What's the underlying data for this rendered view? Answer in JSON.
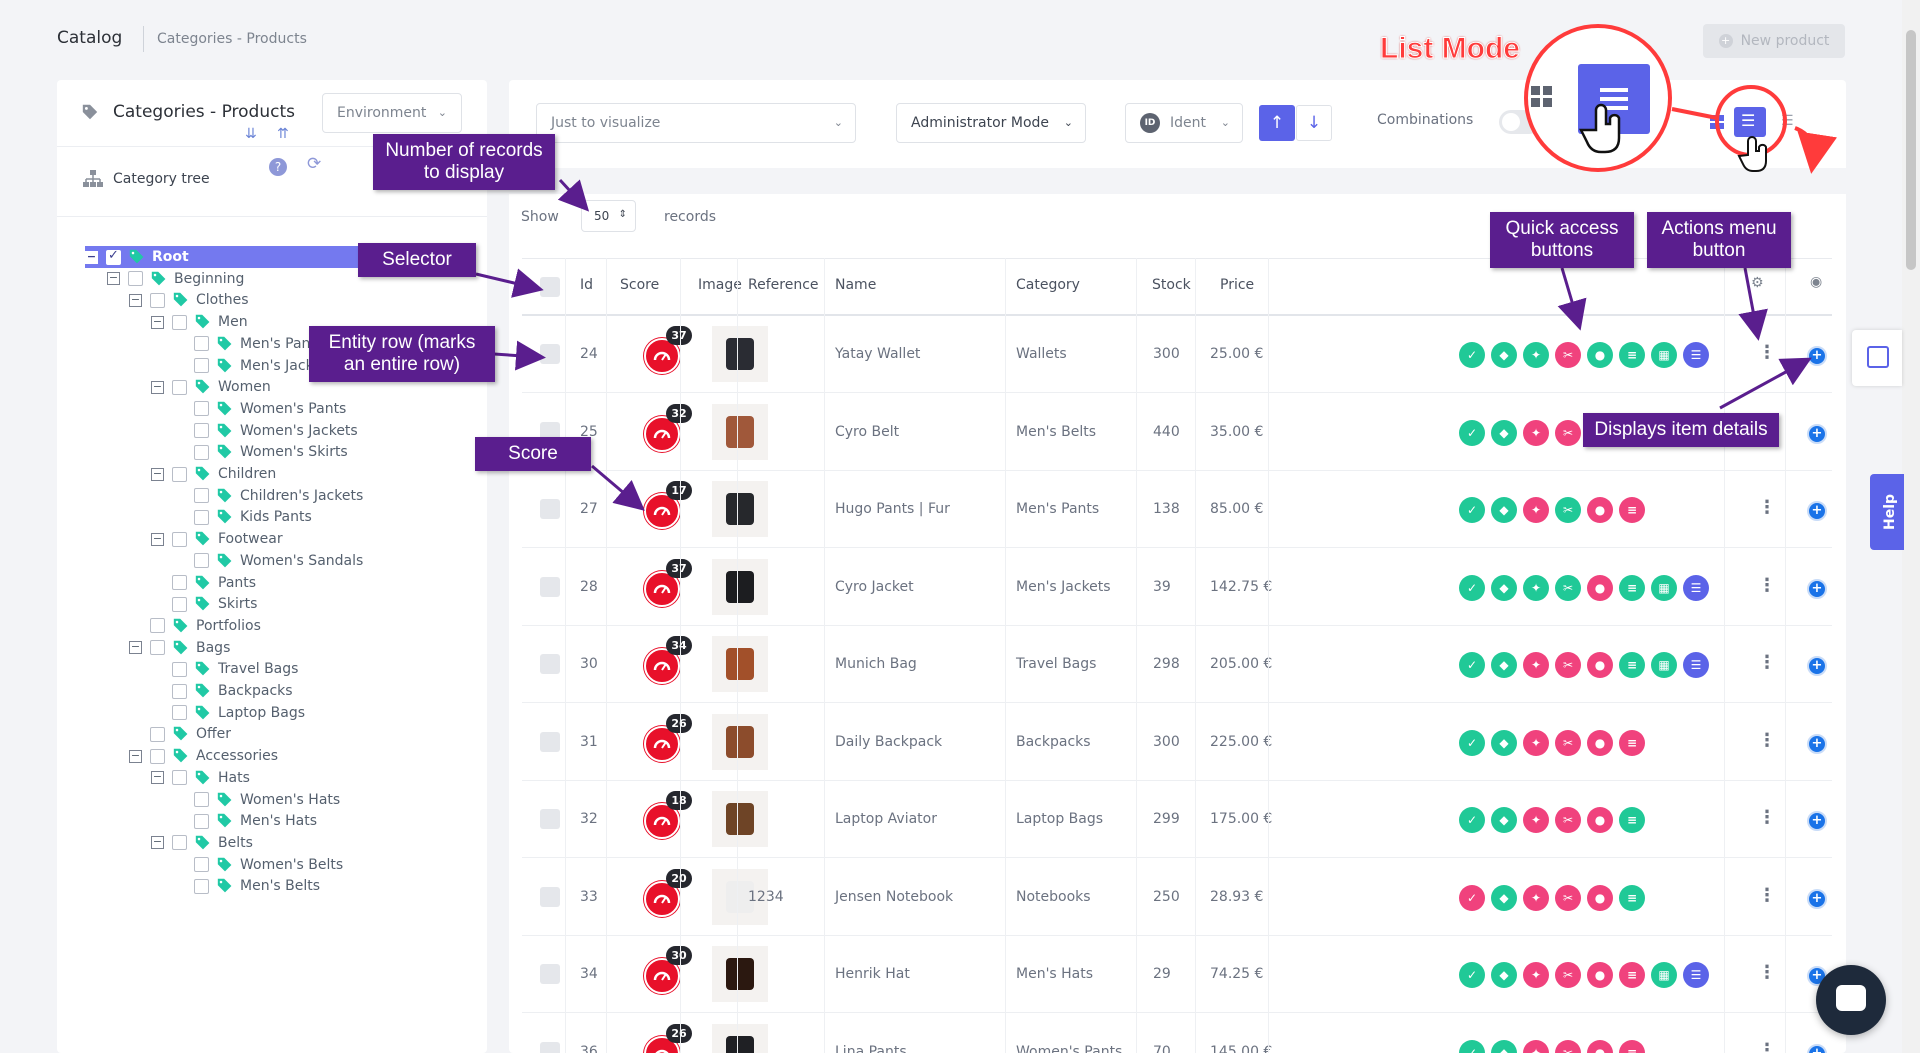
{
  "header": {
    "title": "Catalog",
    "breadcrumb": "Categories - Products",
    "new_product": "New product"
  },
  "left_panel": {
    "title": "Categories - Products",
    "environment": "Environment",
    "category_tree": "Category tree",
    "tree": [
      {
        "label": "Root",
        "level": 0,
        "toggle": "−",
        "root": true
      },
      {
        "label": "Beginning",
        "level": 1,
        "toggle": "−"
      },
      {
        "label": "Clothes",
        "level": 2,
        "toggle": "−"
      },
      {
        "label": "Men",
        "level": 3,
        "toggle": "−"
      },
      {
        "label": "Men's Pants",
        "level": 4,
        "toggle": ""
      },
      {
        "label": "Men's Jackets",
        "level": 4,
        "toggle": ""
      },
      {
        "label": "Women",
        "level": 3,
        "toggle": "−"
      },
      {
        "label": "Women's Pants",
        "level": 4,
        "toggle": ""
      },
      {
        "label": "Women's Jackets",
        "level": 4,
        "toggle": ""
      },
      {
        "label": "Women's Skirts",
        "level": 4,
        "toggle": ""
      },
      {
        "label": "Children",
        "level": 3,
        "toggle": "−"
      },
      {
        "label": "Children's Jackets",
        "level": 4,
        "toggle": ""
      },
      {
        "label": "Kids Pants",
        "level": 4,
        "toggle": ""
      },
      {
        "label": "Footwear",
        "level": 3,
        "toggle": "−"
      },
      {
        "label": "Women's Sandals",
        "level": 4,
        "toggle": ""
      },
      {
        "label": "Pants",
        "level": 3,
        "toggle": ""
      },
      {
        "label": "Skirts",
        "level": 3,
        "toggle": ""
      },
      {
        "label": "Portfolios",
        "level": 2,
        "toggle": ""
      },
      {
        "label": "Bags",
        "level": 2,
        "toggle": "−"
      },
      {
        "label": "Travel Bags",
        "level": 3,
        "toggle": ""
      },
      {
        "label": "Backpacks",
        "level": 3,
        "toggle": ""
      },
      {
        "label": "Laptop Bags",
        "level": 3,
        "toggle": ""
      },
      {
        "label": "Offer",
        "level": 2,
        "toggle": ""
      },
      {
        "label": "Accessories",
        "level": 2,
        "toggle": "−"
      },
      {
        "label": "Hats",
        "level": 3,
        "toggle": "−"
      },
      {
        "label": "Women's Hats",
        "level": 4,
        "toggle": ""
      },
      {
        "label": "Men's Hats",
        "level": 4,
        "toggle": ""
      },
      {
        "label": "Belts",
        "level": 3,
        "toggle": "−"
      },
      {
        "label": "Women's Belts",
        "level": 4,
        "toggle": ""
      },
      {
        "label": "Men's Belts",
        "level": 4,
        "toggle": ""
      }
    ]
  },
  "toolbar": {
    "visualize": "Just to visualize",
    "mode": "Administrator Mode",
    "ident_badge": "ID",
    "ident": "Ident",
    "combinations": "Combinations",
    "show": "Show",
    "records_count": "50",
    "records": "records"
  },
  "table": {
    "headers": [
      "Id",
      "Score",
      "Image",
      "Reference",
      "Name",
      "Category",
      "Stock",
      "Price"
    ],
    "rows": [
      {
        "id": "24",
        "score": "37",
        "reference": "",
        "name": "Yatay Wallet",
        "category": "Wallets",
        "stock": "300",
        "price": "25.00 €",
        "buttons": [
          "green",
          "green",
          "green",
          "pink",
          "green",
          "green",
          "green",
          "blue"
        ],
        "thumb": "#2a2c33"
      },
      {
        "id": "25",
        "score": "32",
        "reference": "",
        "name": "Cyro Belt",
        "category": "Men's Belts",
        "stock": "440",
        "price": "35.00 €",
        "buttons": [
          "green",
          "green",
          "pink",
          "pink",
          "pink",
          "green",
          "green",
          "blue"
        ],
        "thumb": "#a0583a"
      },
      {
        "id": "27",
        "score": "17",
        "reference": "",
        "name": "Hugo Pants | Fur",
        "category": "Men's Pants",
        "stock": "138",
        "price": "85.00 €",
        "buttons": [
          "green",
          "green",
          "pink",
          "green",
          "pink",
          "pink"
        ],
        "thumb": "#26282c"
      },
      {
        "id": "28",
        "score": "37",
        "reference": "",
        "name": "Cyro Jacket",
        "category": "Men's Jackets",
        "stock": "39",
        "price": "142.75 €",
        "buttons": [
          "green",
          "green",
          "green",
          "green",
          "pink",
          "green",
          "green",
          "blue"
        ],
        "thumb": "#1c1d20"
      },
      {
        "id": "30",
        "score": "34",
        "reference": "",
        "name": "Munich Bag",
        "category": "Travel Bags",
        "stock": "298",
        "price": "205.00 €",
        "buttons": [
          "green",
          "green",
          "pink",
          "pink",
          "pink",
          "green",
          "green",
          "blue"
        ],
        "thumb": "#a2502a"
      },
      {
        "id": "31",
        "score": "26",
        "reference": "",
        "name": "Daily Backpack",
        "category": "Backpacks",
        "stock": "300",
        "price": "225.00 €",
        "buttons": [
          "green",
          "green",
          "pink",
          "pink",
          "pink",
          "pink"
        ],
        "thumb": "#8c4c2c"
      },
      {
        "id": "32",
        "score": "18",
        "reference": "",
        "name": "Laptop Aviator",
        "category": "Laptop Bags",
        "stock": "299",
        "price": "175.00 €",
        "buttons": [
          "green",
          "green",
          "pink",
          "pink",
          "pink",
          "green"
        ],
        "thumb": "#6e4426"
      },
      {
        "id": "33",
        "score": "20",
        "reference": "1234",
        "name": "Jensen Notebook",
        "category": "Notebooks",
        "stock": "250",
        "price": "28.93 €",
        "buttons": [
          "pink",
          "green",
          "pink",
          "pink",
          "pink",
          "green"
        ],
        "thumb": "#eeeeee"
      },
      {
        "id": "34",
        "score": "30",
        "reference": "",
        "name": "Henrik Hat",
        "category": "Men's Hats",
        "stock": "29",
        "price": "74.25 €",
        "buttons": [
          "green",
          "green",
          "pink",
          "pink",
          "pink",
          "pink",
          "green",
          "blue"
        ],
        "thumb": "#2b1810"
      },
      {
        "id": "36",
        "score": "26",
        "reference": "",
        "name": "Lina Pants",
        "category": "Women's Pants",
        "stock": "70",
        "price": "145.00 €",
        "buttons": [
          "green",
          "green",
          "pink",
          "pink",
          "pink",
          "pink"
        ],
        "thumb": "#1f2024"
      }
    ]
  },
  "annotations": {
    "list_mode": "List Mode",
    "records_to_display": "Number of records to display",
    "selector": "Selector",
    "entity_row": "Entity row (marks an entire row)",
    "score": "Score",
    "quick_access": "Quick access buttons",
    "actions_menu": "Actions menu button",
    "item_details": "Displays item details"
  },
  "side": {
    "help": "Help"
  },
  "colors": {
    "accent": "#5b63e8",
    "green_button": "#20c997",
    "pink_button": "#f0427d",
    "score_red": "#e8102a",
    "annotation_purple": "#5a1e8e"
  }
}
